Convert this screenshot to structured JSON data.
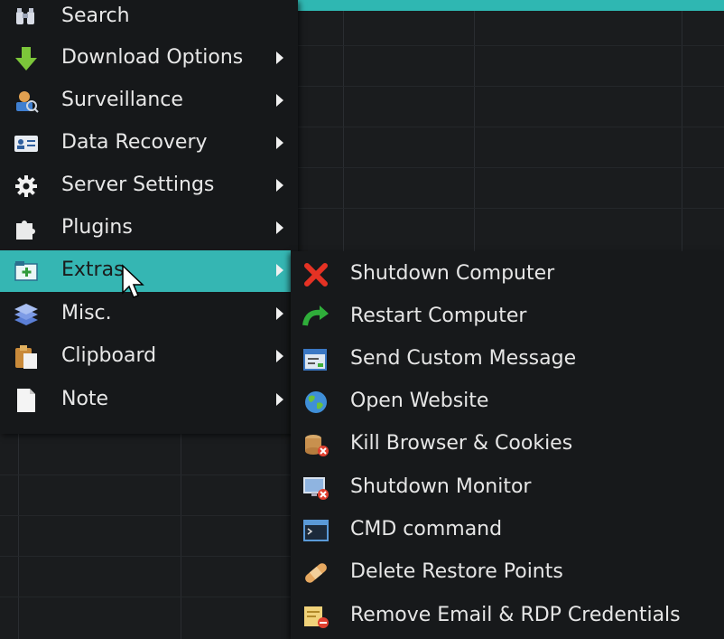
{
  "main_menu": {
    "items": [
      {
        "label": "Search",
        "icon": "binoculars-icon",
        "has_submenu": false
      },
      {
        "label": "Download Options",
        "icon": "download-arrow-icon",
        "has_submenu": true
      },
      {
        "label": "Surveillance",
        "icon": "surveillance-icon",
        "has_submenu": true
      },
      {
        "label": "Data Recovery",
        "icon": "id-card-icon",
        "has_submenu": true
      },
      {
        "label": "Server Settings",
        "icon": "gear-icon",
        "has_submenu": true
      },
      {
        "label": "Plugins",
        "icon": "puzzle-icon",
        "has_submenu": true
      },
      {
        "label": "Extras",
        "icon": "folder-plus-icon",
        "has_submenu": true,
        "selected": true
      },
      {
        "label": "Misc.",
        "icon": "layers-icon",
        "has_submenu": true
      },
      {
        "label": "Clipboard",
        "icon": "clipboard-icon",
        "has_submenu": true
      },
      {
        "label": "Note",
        "icon": "note-icon",
        "has_submenu": true
      }
    ]
  },
  "extras_submenu": {
    "items": [
      {
        "label": "Shutdown Computer",
        "icon": "red-x-icon"
      },
      {
        "label": "Restart Computer",
        "icon": "restart-arrow-icon"
      },
      {
        "label": "Send Custom Message",
        "icon": "message-window-icon"
      },
      {
        "label": "Open Website",
        "icon": "globe-icon"
      },
      {
        "label": "Kill Browser & Cookies",
        "icon": "cookies-delete-icon"
      },
      {
        "label": "Shutdown Monitor",
        "icon": "monitor-off-icon"
      },
      {
        "label": "CMD command",
        "icon": "cmd-window-icon"
      },
      {
        "label": "Delete Restore Points",
        "icon": "bandage-icon"
      },
      {
        "label": "Remove Email & RDP Credentials",
        "icon": "credentials-remove-icon"
      }
    ]
  },
  "colors": {
    "selection": "#35b6b3",
    "menu_bg": "#16181a",
    "text": "#e6e6e6"
  }
}
